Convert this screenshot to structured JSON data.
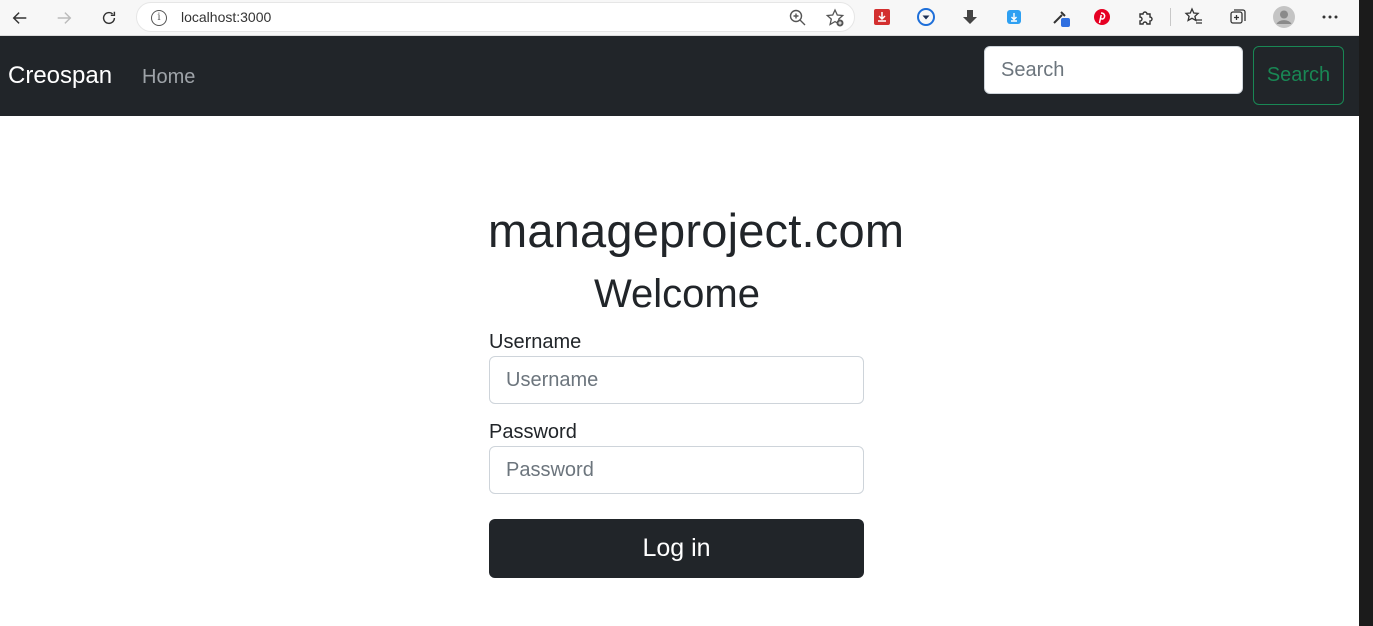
{
  "browser": {
    "url": "localhost:3000",
    "icons": [
      "back-arrow-icon",
      "forward-arrow-icon",
      "reload-icon",
      "info-icon",
      "zoom-icon",
      "add-favorite-icon",
      "extension-red-icon",
      "extension-blue-circle-icon",
      "download-icon",
      "extension-blue-download-icon",
      "eyedropper-icon",
      "pinterest-icon",
      "puzzle-icon",
      "favorites-icon",
      "collections-icon",
      "profile-avatar-icon",
      "more-menu-icon"
    ]
  },
  "navbar": {
    "brand": "Creospan",
    "home_label": "Home",
    "search_placeholder": "Search",
    "search_button_label": "Search",
    "colors": {
      "background": "#212529",
      "search_button": "#198754"
    }
  },
  "main": {
    "site_title": "manageproject.com",
    "welcome": "Welcome",
    "username_label": "Username",
    "username_placeholder": "Username",
    "password_label": "Password",
    "password_placeholder": "Password",
    "login_label": "Log in"
  }
}
